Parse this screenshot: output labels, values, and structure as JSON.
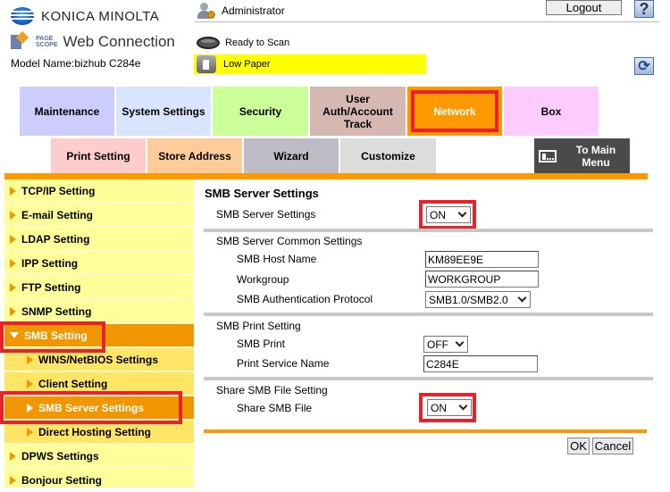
{
  "header": {
    "brand": "KONICA MINOLTA",
    "pagescope_line1": "PAGE",
    "pagescope_line2": "SCOPE",
    "product": "Web Connection",
    "model": "Model Name:bizhub C284e",
    "user": "Administrator",
    "logout_label": "Logout",
    "help_label": "?",
    "refresh_label": "⟳",
    "status": [
      {
        "icon": "scanner-icon",
        "text": "Ready to Scan",
        "highlight": ""
      },
      {
        "icon": "printer-icon",
        "text": "Low Paper",
        "highlight": "#ffff00"
      }
    ]
  },
  "nav": {
    "top_tabs": [
      {
        "label": "Maintenance",
        "color": "#ccccff"
      },
      {
        "label": "System Settings",
        "color": "#d9e5ff"
      },
      {
        "label": "Security",
        "color": "#ccff99"
      },
      {
        "label": "User Auth/Account Track",
        "color": "#d6b8b3"
      },
      {
        "label": "Network",
        "color": "#ff9900",
        "active": true
      },
      {
        "label": "Box",
        "color": "#ffccff"
      }
    ],
    "sub_tabs": [
      {
        "label": "Print Setting",
        "color": "#ffcccc"
      },
      {
        "label": "Store Address",
        "color": "#ffcc99"
      },
      {
        "label": "Wizard",
        "color": "#bfbcc8"
      },
      {
        "label": "Customize",
        "color": "#dcdcdc"
      }
    ],
    "main_menu_label": "To Main Menu",
    "accent": "#ff9900"
  },
  "sidebar": {
    "items": [
      {
        "label": "TCP/IP Setting"
      },
      {
        "label": "E-mail Setting"
      },
      {
        "label": "LDAP Setting"
      },
      {
        "label": "IPP Setting"
      },
      {
        "label": "FTP Setting"
      },
      {
        "label": "SNMP Setting"
      },
      {
        "label": "SMB Setting",
        "expanded": true
      },
      {
        "label": "WINS/NetBIOS Settings",
        "sub": true
      },
      {
        "label": "Client Setting",
        "sub": true
      },
      {
        "label": "SMB Server Settings",
        "sub": true,
        "active": true
      },
      {
        "label": "Direct Hosting Setting",
        "sub": true
      },
      {
        "label": "DPWS Settings"
      },
      {
        "label": "Bonjour Setting"
      }
    ]
  },
  "main": {
    "title": "SMB Server Settings",
    "server_setting": {
      "label": "SMB Server Settings",
      "value": "ON"
    },
    "common": {
      "heading": "SMB Server Common Settings",
      "host_name": {
        "label": "SMB Host Name",
        "value": "KM89EE9E"
      },
      "workgroup": {
        "label": "Workgroup",
        "value": "WORKGROUP"
      },
      "auth_protocol": {
        "label": "SMB Authentication Protocol",
        "value": "SMB1.0/SMB2.0"
      }
    },
    "print": {
      "heading": "SMB Print Setting",
      "smb_print": {
        "label": "SMB Print",
        "value": "OFF"
      },
      "service_name": {
        "label": "Print Service Name",
        "value": "C284E"
      }
    },
    "share": {
      "heading": "Share SMB File Setting",
      "share_file": {
        "label": "Share SMB File",
        "value": "ON"
      }
    },
    "ok_label": "OK",
    "cancel_label": "Cancel"
  }
}
